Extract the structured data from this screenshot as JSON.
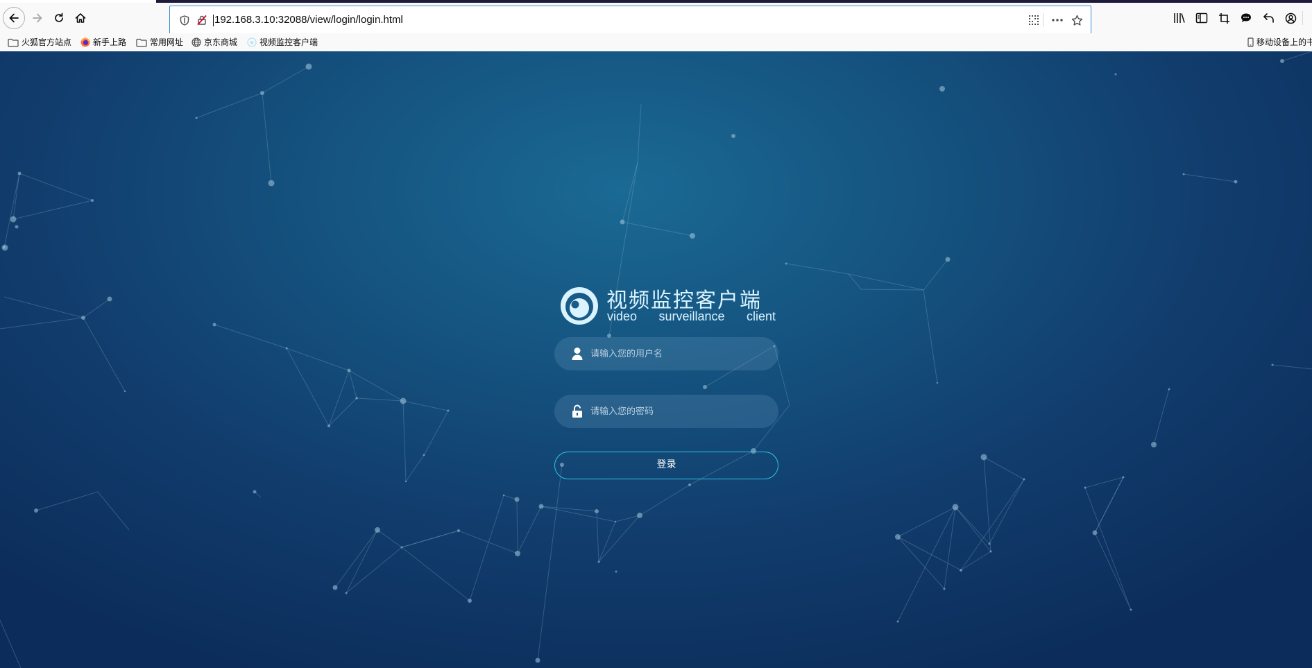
{
  "browser": {
    "url": "192.168.3.10:32088/view/login/login.html",
    "bookmarks": [
      "火狐官方站点",
      "新手上路",
      "常用网址",
      "京东商城",
      "视频监控客户端"
    ],
    "mobile_bookmarks_label": "移动设备上的书"
  },
  "icons": {
    "back": "arrow-left-icon",
    "forward": "arrow-right-icon",
    "reload": "reload-icon",
    "home": "home-icon",
    "tracking": "shield-icon",
    "insecure": "lock-slash-icon",
    "qr": "qr-code-icon",
    "more": "ellipsis-icon",
    "bookmark": "star-icon",
    "library": "library-icon",
    "sidebar": "sidebar-icon",
    "screenshot": "crop-icon",
    "chat": "chat-icon",
    "undo": "undo-icon",
    "account": "account-icon"
  },
  "login": {
    "title": "视频监控客户端",
    "subtitle_words": [
      "video",
      "surveillance",
      "client"
    ],
    "username_placeholder": "请输入您的用户名",
    "password_placeholder": "请输入您的密码",
    "submit_label": "登录"
  },
  "colors": {
    "accent": "#2ac6e6",
    "logo": "#d9f3ff",
    "page_bg_center": "#1a6a94",
    "page_bg_edge": "#0c2d5b"
  }
}
